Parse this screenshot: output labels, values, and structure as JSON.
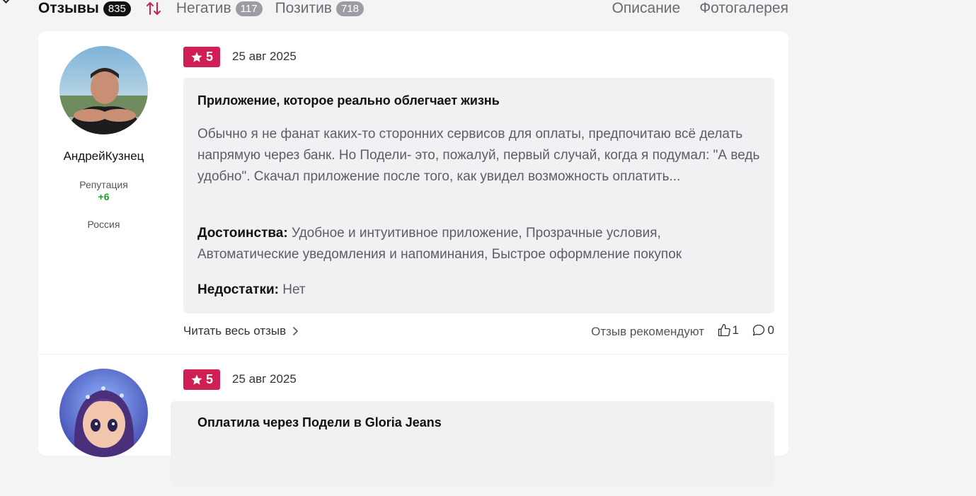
{
  "tabs": {
    "reviews": {
      "label": "Отзывы",
      "count": "835"
    },
    "negative": {
      "label": "Негатив",
      "count": "117"
    },
    "positive": {
      "label": "Позитив",
      "count": "718"
    },
    "description": "Описание",
    "gallery": "Фотогалерея"
  },
  "icons": {
    "sort": "sort-arrows-icon",
    "star": "star-icon",
    "chevron": "chevron-right-icon",
    "like": "thumbs-up-icon",
    "comment": "comment-bubble-icon"
  },
  "colors": {
    "rating_badge": "#cf1f55",
    "reputation": "#1a9c2c",
    "active_badge": "#111111"
  },
  "reviews": [
    {
      "author": "АндрейКузнец",
      "reputation_label": "Репутация",
      "reputation_value": "+6",
      "country": "Россия",
      "rating": "5",
      "date": "25 авг 2025",
      "title": "Приложение, которое реально облегчает жизнь",
      "text": "Обычно я не фанат каких-то сторонних сервисов для оплаты, предпочитаю всё делать напрямую через банк. Но Подели- это, пожалуй, первый случай, когда я подумал: \"А ведь удобно\". Скачал приложение после того, как увидел возможность оплатить...",
      "pros_label": "Достоинства:",
      "pros": "Удобное и интуитивное приложение, Прозрачные условия, Автоматические уведомления и напоминания, Быстрое оформление покупок",
      "cons_label": "Недостатки:",
      "cons": "Нет",
      "read_more": "Читать весь отзыв",
      "recommend_label": "Отзыв рекомендуют",
      "likes": "1",
      "comments": "0"
    },
    {
      "rating": "5",
      "date": "25 авг 2025",
      "title": "Оплатила через Подели в Gloria Jeans"
    }
  ]
}
